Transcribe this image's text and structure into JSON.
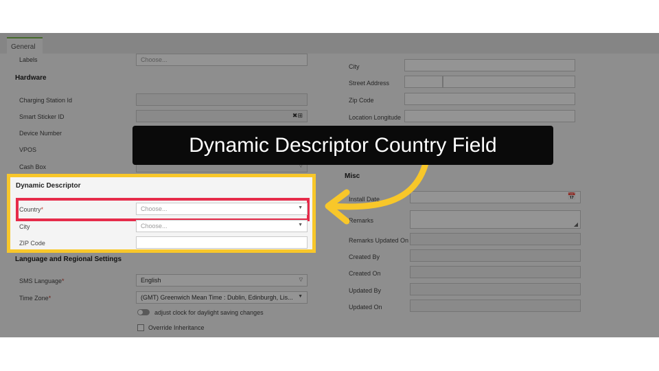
{
  "tab": {
    "general": "General"
  },
  "left": {
    "labels_label": "Labels",
    "labels_placeholder": "Choose...",
    "hardware_heading": "Hardware",
    "charging_station_id": "Charging Station Id",
    "smart_sticker_id": "Smart Sticker ID",
    "device_number": "Device Number",
    "vpos": "VPOS",
    "cash_box": "Cash Box",
    "dynamic_descriptor_heading": "Dynamic Descriptor",
    "country_label": "Country",
    "required_mark": "*",
    "country_placeholder": "Choose...",
    "city_label": "City",
    "city_placeholder": "Choose...",
    "zip_label": "ZIP Code",
    "lang_heading": "Language and Regional Settings",
    "sms_language_label": "SMS Language",
    "sms_language_value": "English",
    "time_zone_label": "Time Zone",
    "time_zone_value": "(GMT) Greenwich Mean Time : Dublin, Edinburgh, Lis...",
    "dst_label": "adjust clock for daylight saving changes",
    "override_label": "Override Inheritance"
  },
  "right": {
    "city": "City",
    "street_address": "Street Address",
    "zip_code": "Zip Code",
    "location_longitude": "Location Longitude",
    "misc_heading": "Misc",
    "install_date": "Install Date",
    "remarks": "Remarks",
    "remarks_updated_on": "Remarks Updated On",
    "created_by": "Created By",
    "created_on": "Created On",
    "updated_by": "Updated By",
    "updated_on": "Updated On"
  },
  "banner": {
    "text": "Dynamic Descriptor Country Field"
  },
  "colors": {
    "highlight_yellow": "#f8c72a",
    "highlight_red": "#e62b4a",
    "tab_accent": "#79b94a"
  }
}
